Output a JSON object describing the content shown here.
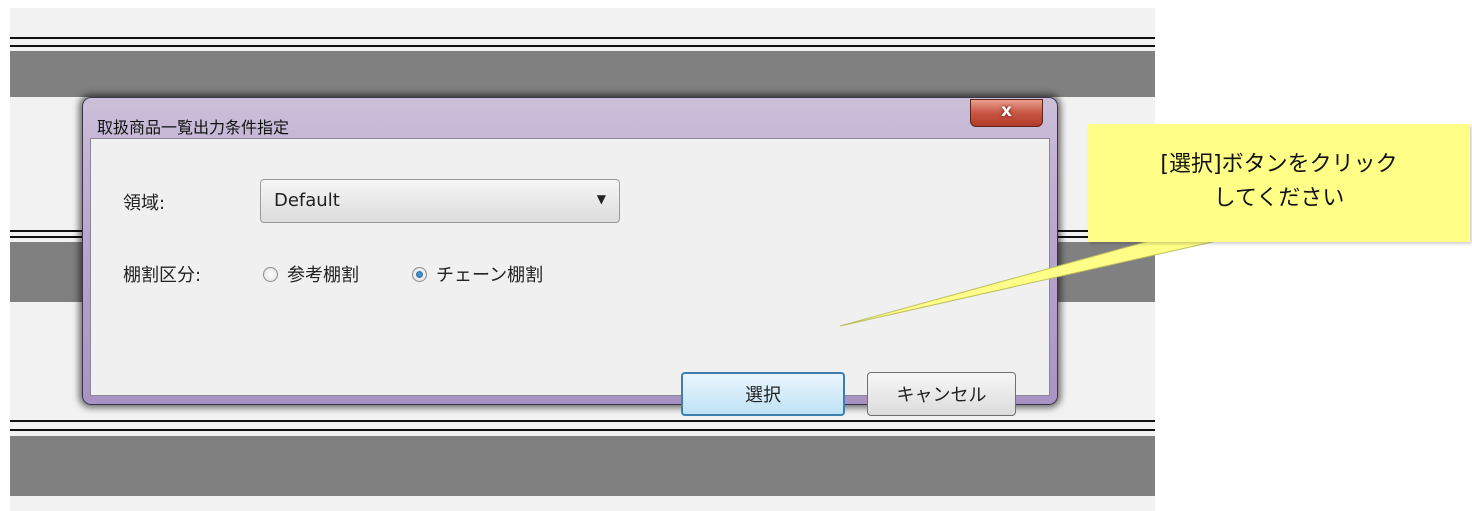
{
  "dialog": {
    "title": "取扱商品一覧出力条件指定",
    "close_glyph": "x",
    "region_label": "領域:",
    "region_value": "Default",
    "region_arrow": "▼",
    "shelf_label": "棚割区分:",
    "radio_options": [
      {
        "label": "参考棚割",
        "checked": false
      },
      {
        "label": "チェーン棚割",
        "checked": true
      }
    ],
    "select_button": "選択",
    "cancel_button": "キャンセル"
  },
  "callout": {
    "line1": "[選択]ボタンをクリック",
    "line2": "してください"
  },
  "colors": {
    "callout_bg": "#ffff88",
    "dialog_frame": "#b8a7cf",
    "close_red": "#c75642",
    "band_gray": "#808080"
  }
}
